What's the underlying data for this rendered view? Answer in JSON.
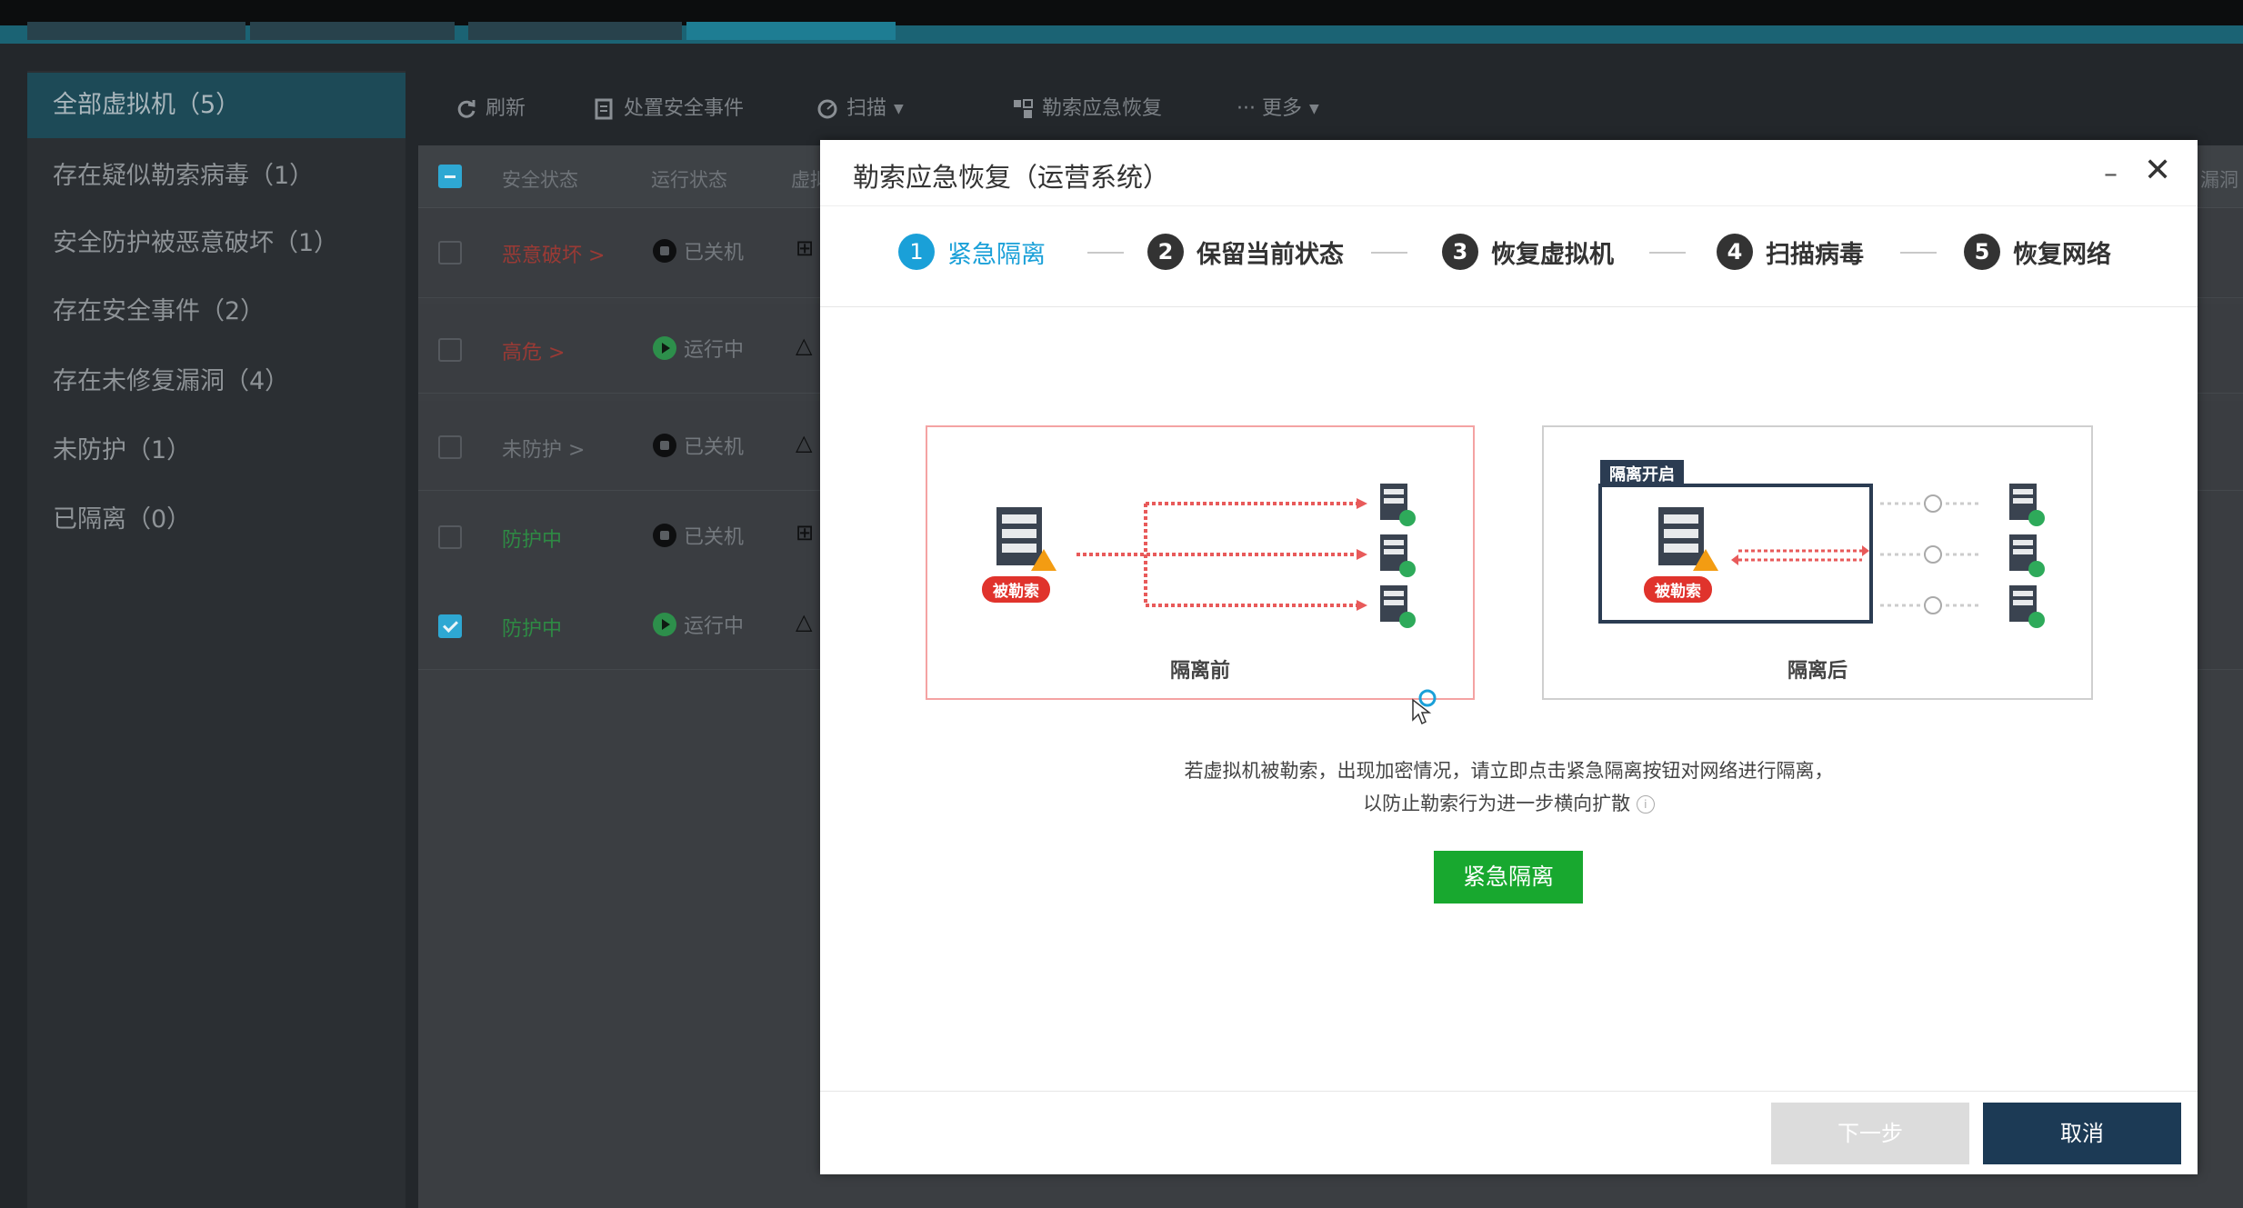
{
  "sidebar": {
    "items": [
      {
        "label": "全部虚拟机（5）",
        "active": true
      },
      {
        "label": "存在疑似勒索病毒（1）"
      },
      {
        "label": "安全防护被恶意破坏（1）"
      },
      {
        "label": "存在安全事件（2）"
      },
      {
        "label": "存在未修复漏洞（4）"
      },
      {
        "label": "未防护（1）"
      },
      {
        "label": "已隔离（0）"
      }
    ]
  },
  "toolbar": {
    "refresh": "刷新",
    "handle_events": "处置安全事件",
    "scan": "扫描",
    "ransom_recovery": "勒索应急恢复",
    "more": "··· 更多"
  },
  "table": {
    "headers": {
      "security_status": "安全状态",
      "run_status": "运行状态",
      "vm": "虚拟",
      "vuln": "漏洞"
    },
    "rows": [
      {
        "security": "恶意破坏 >",
        "security_color": "#9a3a35",
        "run": "已关机",
        "run_state": "off",
        "os": "windows",
        "checked": false
      },
      {
        "security": "高危 >",
        "security_color": "#9a3a35",
        "run": "运行中",
        "run_state": "on",
        "os": "linux",
        "checked": false
      },
      {
        "security": "未防护 >",
        "security_color": "#6e7378",
        "run": "已关机",
        "run_state": "off",
        "os": "linux",
        "checked": false
      },
      {
        "security": "防护中",
        "security_color": "#2e8a44",
        "run": "已关机",
        "run_state": "off",
        "os": "windows",
        "checked": false
      },
      {
        "security": "防护中",
        "security_color": "#2e8a44",
        "run": "运行中",
        "run_state": "on",
        "os": "linux",
        "checked": true
      }
    ]
  },
  "modal": {
    "title": "勒索应急恢复（运营系统）",
    "minimize": "–",
    "close": "✕",
    "steps": [
      {
        "num": "1",
        "label": "紧急隔离",
        "active": true
      },
      {
        "num": "2",
        "label": "保留当前状态"
      },
      {
        "num": "3",
        "label": "恢复虚拟机"
      },
      {
        "num": "4",
        "label": "扫描病毒"
      },
      {
        "num": "5",
        "label": "恢复网络"
      }
    ],
    "before_caption": "隔离前",
    "after_caption": "隔离后",
    "ransomed_badge": "被勒索",
    "isolation_on_tag": "隔离开启",
    "description_line1": "若虚拟机被勒索，出现加密情况，请立即点击紧急隔离按钮对网络进行隔离，",
    "description_line2": "以防止勒索行为进一步横向扩散",
    "isolate_button": "紧急隔离",
    "next_button": "下一步",
    "cancel_button": "取消"
  }
}
